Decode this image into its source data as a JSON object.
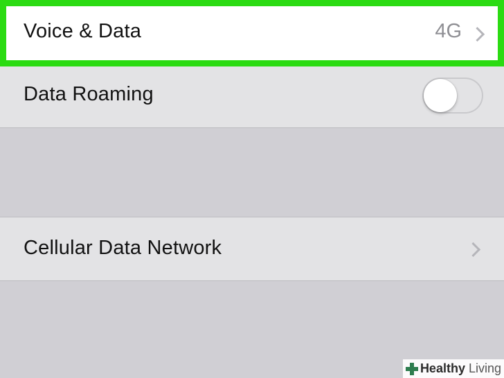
{
  "voice_data": {
    "label": "Voice & Data",
    "value": "4G",
    "chevron_icon": "chevron-right-icon",
    "highlight_color": "#2bdb12"
  },
  "data_roaming": {
    "label": "Data Roaming",
    "toggle_on": false
  },
  "cellular_data_network": {
    "label": "Cellular Data Network",
    "chevron_icon": "chevron-right-icon"
  },
  "watermark": {
    "brand": "Healthy",
    "sub": "Living",
    "icon": "plus-cross-icon"
  }
}
